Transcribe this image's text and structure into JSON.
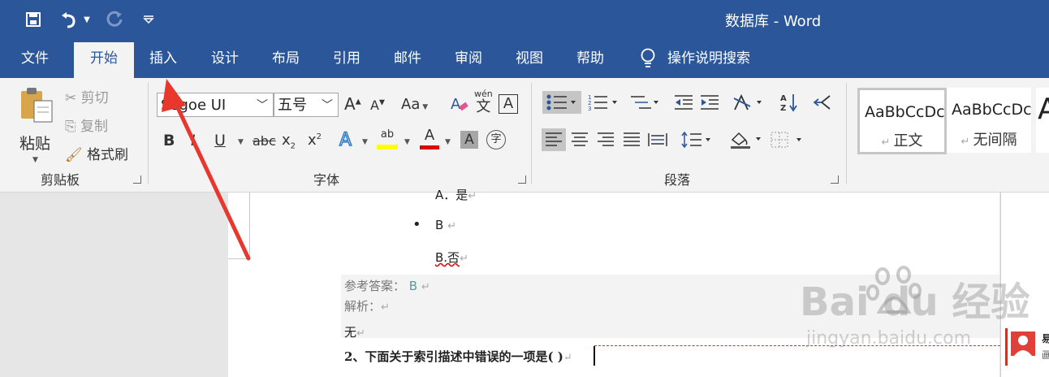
{
  "window": {
    "title": "数据库  -  Word"
  },
  "quick_access": {
    "save": "save-icon",
    "undo": "undo-icon",
    "redo": "redo-icon",
    "customize": "customize-icon"
  },
  "tabs": [
    {
      "label": "文件"
    },
    {
      "label": "开始",
      "active": true
    },
    {
      "label": "插入"
    },
    {
      "label": "设计"
    },
    {
      "label": "布局"
    },
    {
      "label": "引用"
    },
    {
      "label": "邮件"
    },
    {
      "label": "审阅"
    },
    {
      "label": "视图"
    },
    {
      "label": "帮助"
    }
  ],
  "tell_me": {
    "label": "操作说明搜索"
  },
  "clipboard": {
    "paste": "粘贴",
    "cut": "剪切",
    "copy": "复制",
    "format_painter": "格式刷",
    "group": "剪贴板"
  },
  "font": {
    "name": "Segoe UI",
    "size": "五号",
    "group": "字体",
    "grow": "A",
    "shrink": "A",
    "case": "Aa",
    "phonetic_top": "wén",
    "phonetic_char": "文",
    "border_char": "A",
    "bold": "B",
    "italic": "I",
    "underline": "U",
    "strike": "abc",
    "sub": "x",
    "sub_mark": "2",
    "sup": "x",
    "sup_mark": "2",
    "effects": "A",
    "highlight": "ab",
    "color": "A",
    "shade": "A",
    "enclose": "字"
  },
  "paragraph": {
    "group": "段落"
  },
  "styles": [
    {
      "sample": "AaBbCcDc",
      "name": "正文",
      "selected": true
    },
    {
      "sample": "AaBbCcDc",
      "name": "无间隔"
    },
    {
      "sample": "A",
      "name": ""
    }
  ],
  "document": {
    "lines": {
      "a_yes": "A．是",
      "b": "B",
      "b_no": "B.否",
      "answer_label": "参考答案：",
      "answer_value": "B",
      "analysis": "解析：",
      "none": "无",
      "question": "2、下面关于索引描述中错误的一项是(      )"
    },
    "bullet": "•",
    "para_mark": "↵"
  },
  "comment": {
    "text_1": "易",
    "text_2": "画"
  },
  "watermark": {
    "brand": "Bai  du 经验",
    "url": "jingyan.baidu.com"
  },
  "colors": {
    "word_blue": "#2b579a",
    "annotation_red": "#e8372d",
    "highlight_yellow": "#ffff00",
    "font_red": "#e00000"
  }
}
